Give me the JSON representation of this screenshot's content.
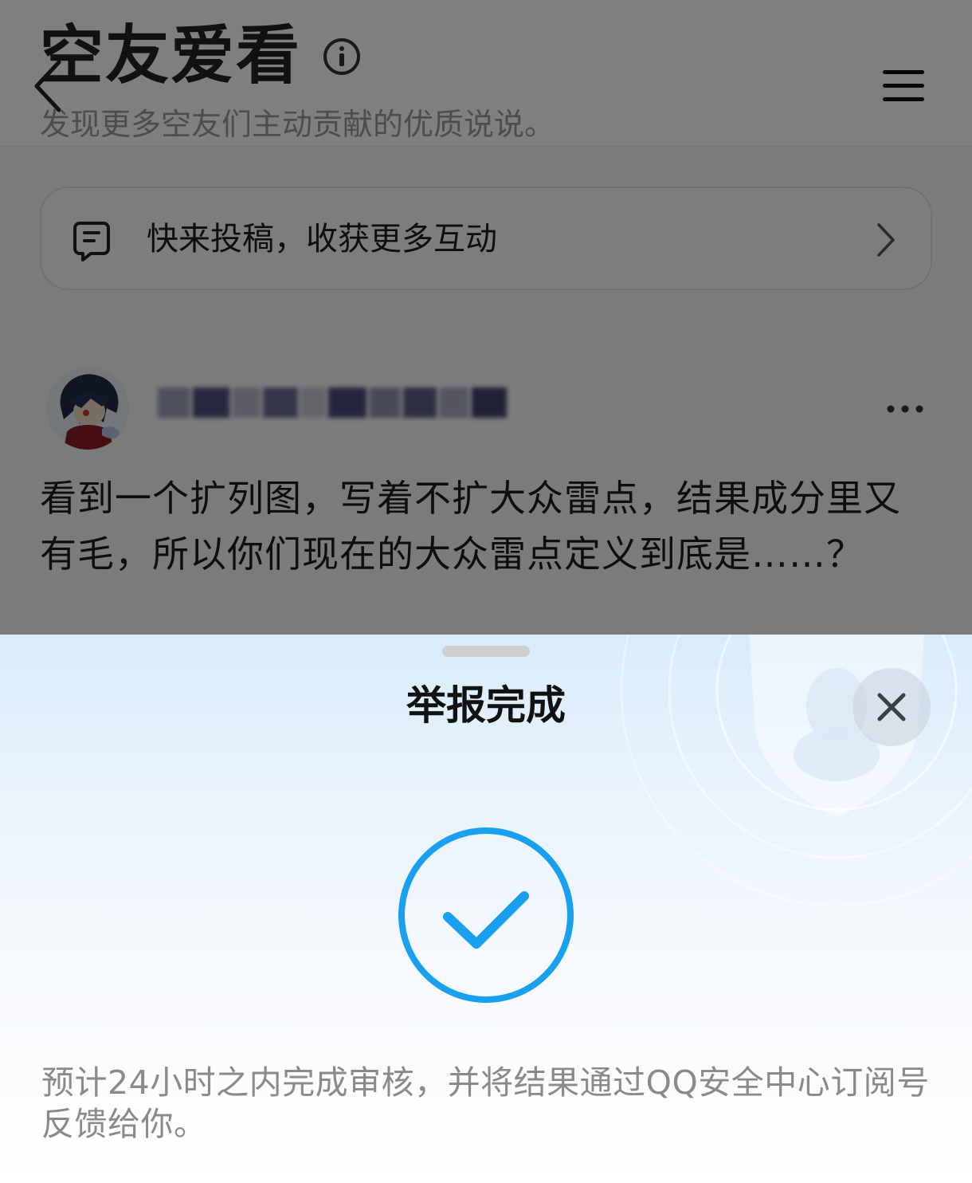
{
  "header": {
    "title": "空友爱看",
    "subtitle": "发现更多空友们主动贡献的优质说说。",
    "info_icon": "info-circle-icon",
    "back_icon": "back-chevron-icon",
    "menu_icon": "hamburger-menu-icon"
  },
  "submit_bar": {
    "label": "快来投稿，收获更多互动",
    "icon": "submit-post-icon"
  },
  "post": {
    "username": "",
    "text": "看到一个扩列图，写着不扩大众雷点，结果成分里又有毛，所以你们现在的大众雷点定义到底是……？",
    "more_icon": "more-horizontal-icon"
  },
  "report_sheet": {
    "title": "举报完成",
    "description": "预计24小时之内完成审核，并将结果通过QQ安全中心订阅号反馈给你。",
    "check_icon": "success-check-icon",
    "close_icon": "close-icon",
    "accent_color": "#1aa0f0"
  }
}
